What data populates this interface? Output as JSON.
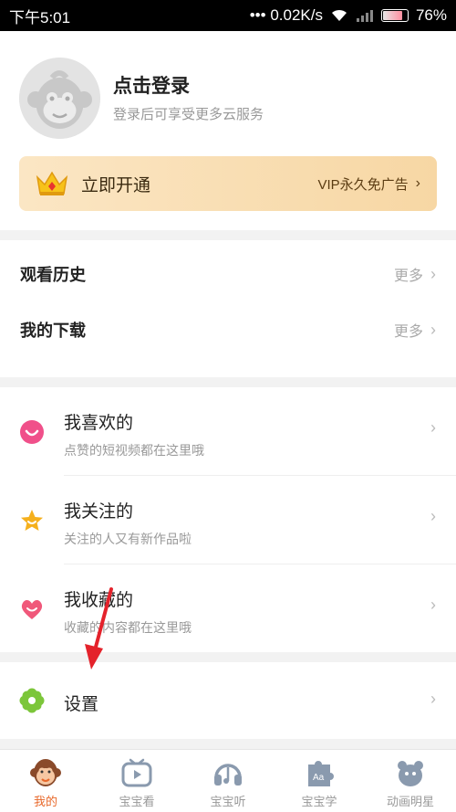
{
  "status_bar": {
    "time": "下午5:01",
    "network": "••• 0.02K/s",
    "battery": "76%"
  },
  "profile": {
    "login_title": "点击登录",
    "login_subtitle": "登录后可享受更多云服务"
  },
  "vip": {
    "open_label": "立即开通",
    "promo": "VIP永久免广告"
  },
  "list1": [
    {
      "label": "观看历史",
      "more": "更多"
    },
    {
      "label": "我的下载",
      "more": "更多"
    }
  ],
  "list2": [
    {
      "title": "我喜欢的",
      "subtitle": "点赞的短视频都在这里哦",
      "icon": "heart-smile-icon"
    },
    {
      "title": "我关注的",
      "subtitle": "关注的人又有新作品啦",
      "icon": "star-icon"
    },
    {
      "title": "我收藏的",
      "subtitle": "收藏的内容都在这里哦",
      "icon": "heart-icon"
    }
  ],
  "settings": {
    "label": "设置",
    "icon": "gear-flower-icon"
  },
  "tabs": [
    {
      "label": "我的",
      "icon": "monkey-icon",
      "active": true
    },
    {
      "label": "宝宝看",
      "icon": "tv-play-icon",
      "active": false
    },
    {
      "label": "宝宝听",
      "icon": "headphones-icon",
      "active": false
    },
    {
      "label": "宝宝学",
      "icon": "puzzle-icon",
      "active": false
    },
    {
      "label": "动画明星",
      "icon": "cartoon-icon",
      "active": false
    }
  ],
  "colors": {
    "accent_tab": "#e8682a",
    "vip_gradient_start": "#fbe6c4",
    "vip_gradient_end": "#f7d7a4",
    "like_icon": "#f0508a",
    "follow_icon": "#f5b01d",
    "collect_icon": "#f0587a",
    "settings_icon": "#7cc63a",
    "annotation_arrow": "#e4222b"
  }
}
